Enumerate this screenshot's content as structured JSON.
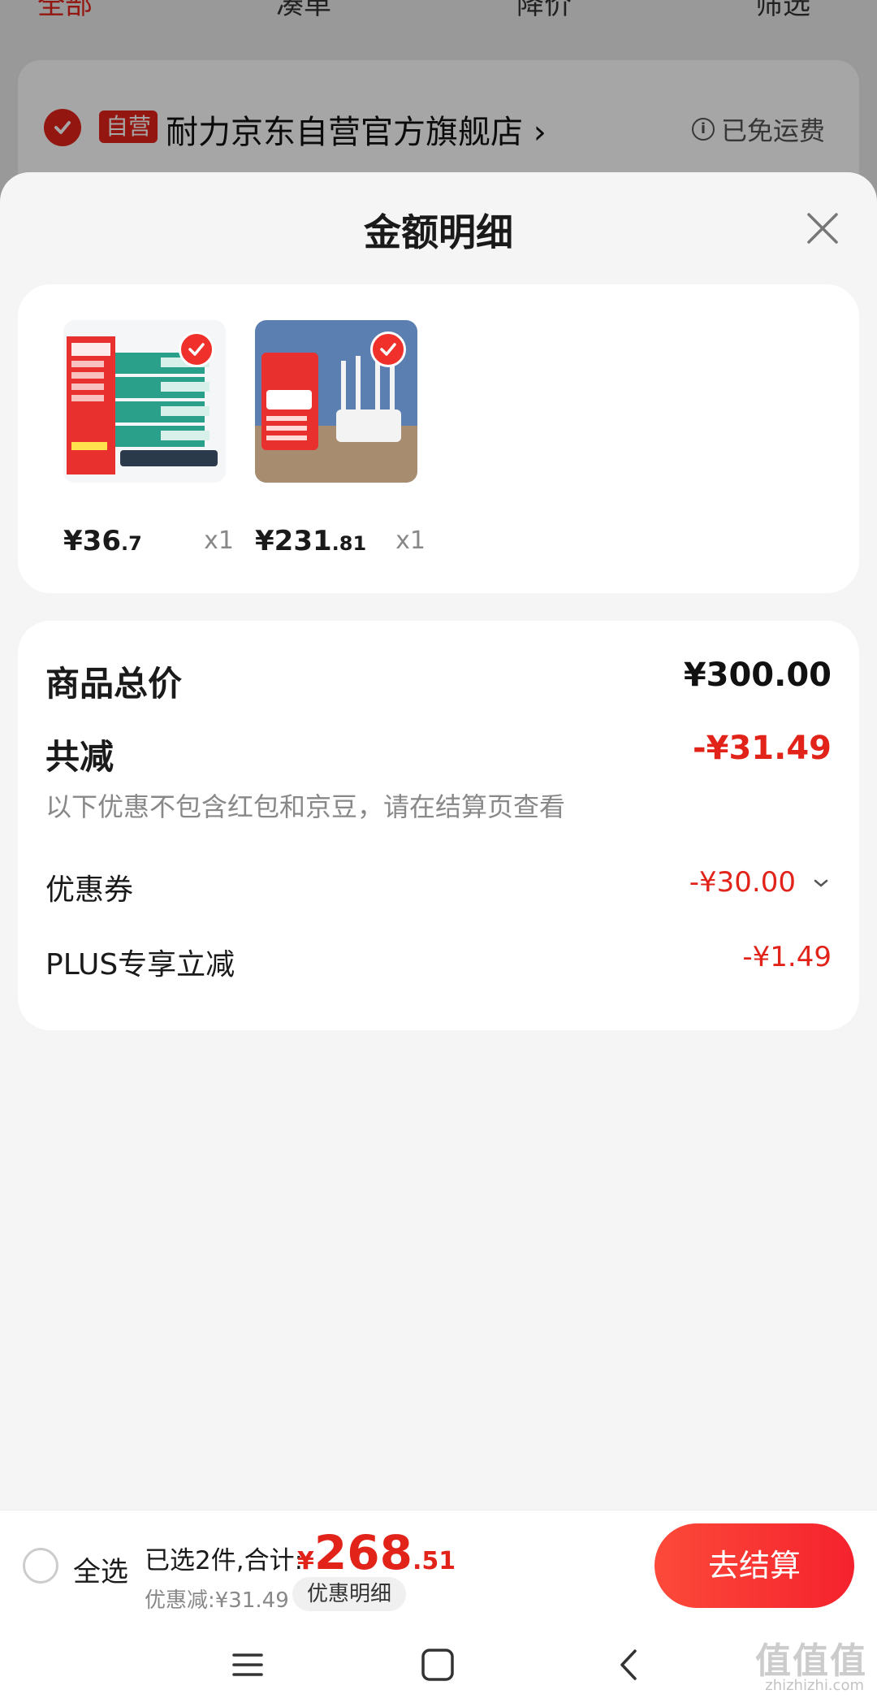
{
  "background": {
    "tabs": [
      "全部",
      "凑单",
      "降价",
      "筛选"
    ],
    "store": {
      "badge": "自营",
      "name": "耐力京东自营官方旗舰店 ›",
      "shipping": "已免运费",
      "info_glyph": "i"
    }
  },
  "sheet": {
    "title": "金额明细",
    "products": [
      {
        "price_int": "¥36",
        "price_dec": ".7",
        "qty": "x1"
      },
      {
        "price_int": "¥231",
        "price_dec": ".81",
        "qty": "x1"
      }
    ],
    "summary": {
      "total_label": "商品总价",
      "total_value": "¥300.00",
      "reduce_label": "共减",
      "reduce_value": "-¥31.49",
      "note": "以下优惠不包含红包和京豆，请在结算页查看",
      "coupon_label": "优惠券",
      "coupon_value": "-¥30.00",
      "plus_label": "PLUS专享立减",
      "plus_value": "-¥1.49"
    }
  },
  "bottom_bar": {
    "select_all": "全选",
    "selected_text": "已选2件,合计:",
    "total_currency": "¥",
    "total_int": "268",
    "total_dec": ".51",
    "discount_text": "优惠减:¥31.49",
    "detail_button": "优惠明细",
    "checkout_button": "去结算"
  },
  "watermark": {
    "text": "值值值",
    "sub": "zhizhizhi.com"
  },
  "colors": {
    "accent": "#e2231a",
    "checkout": "#f5222d"
  }
}
